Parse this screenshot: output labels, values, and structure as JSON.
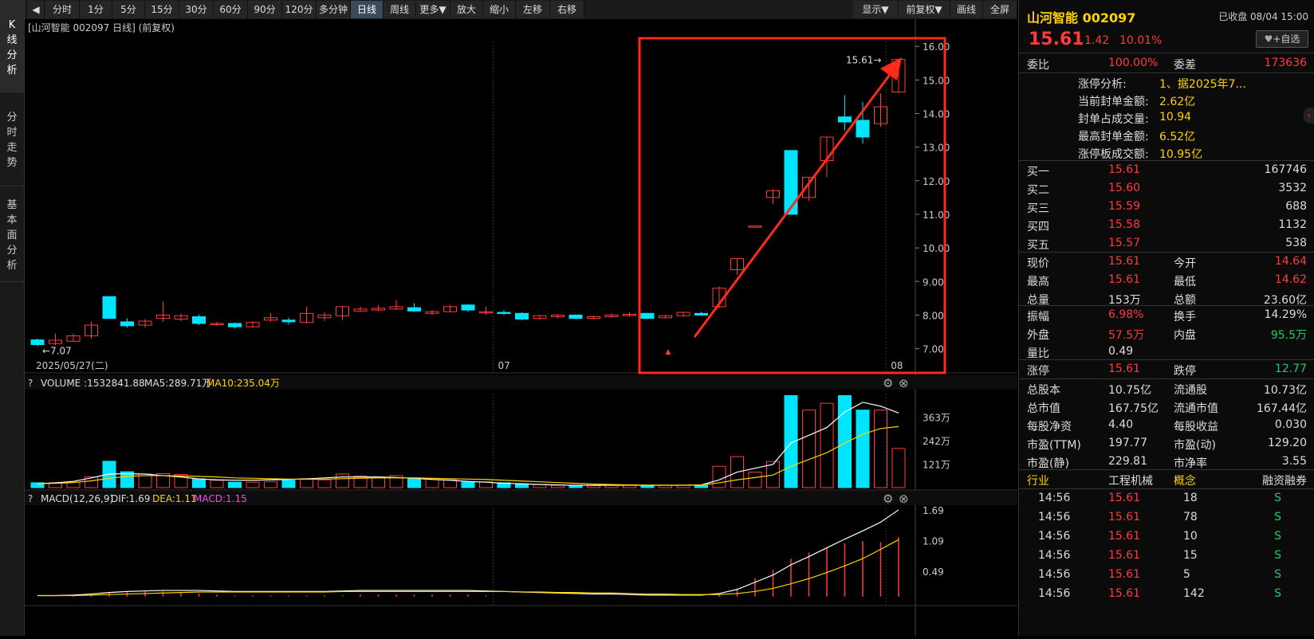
{
  "sidebar": {
    "tabs": [
      "K\n线\n分\n析",
      "分\n时\n走\n势",
      "基\n本\n面\n分\n析"
    ]
  },
  "toolbar": {
    "buttons": [
      "分时",
      "1分",
      "5分",
      "15分",
      "30分",
      "60分",
      "90分",
      "120分",
      "多分钟",
      "日线",
      "周线",
      "更多▼",
      "放大",
      "缩小",
      "左移",
      "右移"
    ],
    "right_buttons": [
      "显示▼",
      "前复权▼",
      "画线",
      "全屏"
    ],
    "active": "日线"
  },
  "chart": {
    "header": "[山河智能 002097 日线] (前复权)",
    "date_label": "2025/05/27(二)",
    "month_labels": [
      "07",
      "08"
    ],
    "low_marker": "7.07",
    "high_marker": "15.61",
    "price_ticks": [
      "16.00",
      "15.00",
      "14.00",
      "13.00",
      "12.00",
      "11.00",
      "10.00",
      "9.00",
      "8.00",
      "7.00"
    ]
  },
  "volume": {
    "label": "VOLUME",
    "value": ":1532841.88",
    "ma5": "MA5:289.71万",
    "ma10": "MA10:235.04万",
    "ticks": [
      "363万",
      "242万",
      "121万"
    ]
  },
  "macd": {
    "label": "MACD(12,26,9)",
    "dif": "DIF:1.69",
    "dea": "DEA:1.11",
    "macd": "MACD:1.15",
    "ticks": [
      "1.69",
      "1.09",
      "0.49"
    ]
  },
  "colors": {
    "up": "#ff3b3b",
    "down": "#00e5ff",
    "accent": "#ffd200",
    "annotation": "#ff2a1a"
  },
  "quote": {
    "name": "山河智能 002097",
    "status": "已收盘 08/04 15:00",
    "price": "15.61",
    "change": "1.42",
    "pct": "10.01%",
    "fav": "+自选",
    "webi_label": "委比",
    "webi": "100.00%",
    "weicha_label": "委差",
    "weicha": "173636",
    "limit_rows": [
      {
        "label": "涨停分析:",
        "value": "1、据2025年7..."
      },
      {
        "label": "当前封单金额:",
        "value": "2.62亿"
      },
      {
        "label": "封单占成交量:",
        "value": "10.94"
      },
      {
        "label": "最高封单金额:",
        "value": "6.52亿"
      },
      {
        "label": "涨停板成交额:",
        "value": "10.95亿"
      }
    ],
    "bids": [
      {
        "label": "买一",
        "price": "15.61",
        "vol": "167746"
      },
      {
        "label": "买二",
        "price": "15.60",
        "vol": "3532"
      },
      {
        "label": "买三",
        "price": "15.59",
        "vol": "688"
      },
      {
        "label": "买四",
        "price": "15.58",
        "vol": "1132"
      },
      {
        "label": "买五",
        "price": "15.57",
        "vol": "538"
      }
    ],
    "stats1": [
      {
        "l1": "现价",
        "v1": "15.61",
        "c1": "red",
        "l2": "今开",
        "v2": "14.64",
        "c2": "red"
      },
      {
        "l1": "最高",
        "v1": "15.61",
        "c1": "red",
        "l2": "最低",
        "v2": "14.62",
        "c2": "red"
      },
      {
        "l1": "总量",
        "v1": "153万",
        "c1": "white",
        "l2": "总额",
        "v2": "23.60亿",
        "c2": "white"
      }
    ],
    "stats2": [
      {
        "l1": "振幅",
        "v1": "6.98%",
        "c1": "red",
        "l2": "换手",
        "v2": "14.29%",
        "c2": "white"
      },
      {
        "l1": "外盘",
        "v1": "57.5万",
        "c1": "red",
        "l2": "内盘",
        "v2": "95.5万",
        "c2": "green"
      },
      {
        "l1": "量比",
        "v1": "0.49",
        "c1": "white",
        "l2": "",
        "v2": "",
        "c2": "white"
      }
    ],
    "stats3": [
      {
        "l1": "涨停",
        "v1": "15.61",
        "c1": "red",
        "l2": "跌停",
        "v2": "12.77",
        "c2": "green"
      }
    ],
    "stats4": [
      {
        "l1": "总股本",
        "v1": "10.75亿",
        "c1": "white",
        "l2": "流通股",
        "v2": "10.73亿",
        "c2": "white"
      },
      {
        "l1": "总市值",
        "v1": "167.75亿",
        "c1": "white",
        "l2": "流通市值",
        "v2": "167.44亿",
        "c2": "white"
      },
      {
        "l1": "每股净资",
        "v1": "4.40",
        "c1": "white",
        "l2": "每股收益",
        "v2": "0.030",
        "c2": "white"
      },
      {
        "l1": "市盈(TTM)",
        "v1": "197.77",
        "c1": "white",
        "l2": "市盈(动)",
        "v2": "129.20",
        "c2": "white"
      },
      {
        "l1": "市盈(静)",
        "v1": "229.81",
        "c1": "white",
        "l2": "市净率",
        "v2": "3.55",
        "c2": "white"
      }
    ],
    "industry": {
      "l1": "行业",
      "v1": "工程机械",
      "l2": "概念",
      "v2": "融资融券"
    },
    "ticks": [
      {
        "time": "14:56",
        "price": "15.61",
        "vol": "18",
        "side": "S"
      },
      {
        "time": "14:56",
        "price": "15.61",
        "vol": "78",
        "side": "S"
      },
      {
        "time": "14:56",
        "price": "15.61",
        "vol": "10",
        "side": "S"
      },
      {
        "time": "14:56",
        "price": "15.61",
        "vol": "15",
        "side": "S"
      },
      {
        "time": "14:56",
        "price": "15.61",
        "vol": "5",
        "side": "S"
      },
      {
        "time": "14:56",
        "price": "15.61",
        "vol": "142",
        "side": "S"
      }
    ]
  },
  "chart_data": {
    "type": "candlestick",
    "title": "山河智能 002097 日线",
    "ylim": [
      6.8,
      16.1
    ],
    "candles": [
      {
        "o": 7.26,
        "c": 7.12,
        "h": 7.3,
        "l": 7.07
      },
      {
        "o": 7.15,
        "c": 7.25,
        "h": 7.45,
        "l": 7.1
      },
      {
        "o": 7.22,
        "c": 7.38,
        "h": 7.45,
        "l": 7.2
      },
      {
        "o": 7.38,
        "c": 7.7,
        "h": 7.8,
        "l": 7.3
      },
      {
        "o": 8.55,
        "c": 7.9,
        "h": 8.55,
        "l": 7.88
      },
      {
        "o": 7.8,
        "c": 7.68,
        "h": 7.9,
        "l": 7.62
      },
      {
        "o": 7.7,
        "c": 7.82,
        "h": 7.88,
        "l": 7.62
      },
      {
        "o": 7.9,
        "c": 8.0,
        "h": 8.4,
        "l": 7.8
      },
      {
        "o": 7.88,
        "c": 7.98,
        "h": 8.05,
        "l": 7.82
      },
      {
        "o": 7.95,
        "c": 7.75,
        "h": 8.02,
        "l": 7.7
      },
      {
        "o": 7.72,
        "c": 7.75,
        "h": 7.8,
        "l": 7.68
      },
      {
        "o": 7.75,
        "c": 7.65,
        "h": 7.78,
        "l": 7.6
      },
      {
        "o": 7.65,
        "c": 7.78,
        "h": 7.82,
        "l": 7.62
      },
      {
        "o": 7.85,
        "c": 7.92,
        "h": 8.05,
        "l": 7.8
      },
      {
        "o": 7.85,
        "c": 7.8,
        "h": 7.92,
        "l": 7.72
      },
      {
        "o": 7.78,
        "c": 8.05,
        "h": 8.25,
        "l": 7.75
      },
      {
        "o": 7.92,
        "c": 8.0,
        "h": 8.08,
        "l": 7.82
      },
      {
        "o": 7.98,
        "c": 8.25,
        "h": 8.25,
        "l": 7.85
      },
      {
        "o": 8.12,
        "c": 8.18,
        "h": 8.25,
        "l": 8.1
      },
      {
        "o": 8.15,
        "c": 8.2,
        "h": 8.3,
        "l": 8.12
      },
      {
        "o": 8.18,
        "c": 8.25,
        "h": 8.45,
        "l": 8.15
      },
      {
        "o": 8.22,
        "c": 8.12,
        "h": 8.35,
        "l": 8.1
      },
      {
        "o": 8.05,
        "c": 8.1,
        "h": 8.15,
        "l": 8.0
      },
      {
        "o": 8.1,
        "c": 8.25,
        "h": 8.3,
        "l": 8.08
      },
      {
        "o": 8.3,
        "c": 8.15,
        "h": 8.32,
        "l": 8.1
      },
      {
        "o": 8.1,
        "c": 8.1,
        "h": 8.25,
        "l": 8.0
      },
      {
        "o": 8.08,
        "c": 8.05,
        "h": 8.15,
        "l": 8.0
      },
      {
        "o": 8.05,
        "c": 7.88,
        "h": 8.08,
        "l": 7.85
      },
      {
        "o": 7.9,
        "c": 7.98,
        "h": 8.0,
        "l": 7.85
      },
      {
        "o": 7.95,
        "c": 8.0,
        "h": 8.02,
        "l": 7.9
      },
      {
        "o": 8.0,
        "c": 7.9,
        "h": 8.02,
        "l": 7.88
      },
      {
        "o": 7.9,
        "c": 7.95,
        "h": 7.98,
        "l": 7.88
      },
      {
        "o": 7.95,
        "c": 8.0,
        "h": 8.05,
        "l": 7.92
      },
      {
        "o": 8.0,
        "c": 8.02,
        "h": 8.08,
        "l": 7.95
      },
      {
        "o": 8.05,
        "c": 7.9,
        "h": 8.05,
        "l": 7.88
      },
      {
        "o": 7.92,
        "c": 7.98,
        "h": 8.0,
        "l": 7.9
      },
      {
        "o": 7.98,
        "c": 8.08,
        "h": 8.1,
        "l": 7.95
      },
      {
        "o": 8.05,
        "c": 8.0,
        "h": 8.1,
        "l": 7.98
      },
      {
        "o": 8.25,
        "c": 8.8,
        "h": 8.85,
        "l": 8.2
      },
      {
        "o": 9.35,
        "c": 9.68,
        "h": 9.68,
        "l": 9.2
      },
      {
        "o": 10.65,
        "c": 10.65,
        "h": 10.65,
        "l": 10.65
      },
      {
        "o": 11.5,
        "c": 11.7,
        "h": 11.75,
        "l": 11.3
      },
      {
        "o": 12.9,
        "c": 11.0,
        "h": 12.9,
        "l": 11.0
      },
      {
        "o": 11.5,
        "c": 12.1,
        "h": 12.1,
        "l": 11.4
      },
      {
        "o": 12.6,
        "c": 13.3,
        "h": 13.3,
        "l": 12.1
      },
      {
        "o": 13.9,
        "c": 13.75,
        "h": 14.55,
        "l": 13.5
      },
      {
        "o": 13.8,
        "c": 13.3,
        "h": 14.35,
        "l": 13.1
      },
      {
        "o": 13.7,
        "c": 14.2,
        "h": 14.6,
        "l": 13.6
      },
      {
        "o": 14.64,
        "c": 15.61,
        "h": 15.61,
        "l": 14.62
      }
    ],
    "volume": [
      0.25,
      0.25,
      0.28,
      0.55,
      1.36,
      0.82,
      0.7,
      0.72,
      0.68,
      0.45,
      0.38,
      0.28,
      0.28,
      0.3,
      0.38,
      0.46,
      0.4,
      0.7,
      0.6,
      0.5,
      0.62,
      0.5,
      0.48,
      0.4,
      0.28,
      0.3,
      0.25,
      0.18,
      0.16,
      0.12,
      0.1,
      0.1,
      0.12,
      0.14,
      0.1,
      0.12,
      0.12,
      0.12,
      1.1,
      1.6,
      0.8,
      1.35,
      4.75,
      4.0,
      4.35,
      4.75,
      4.0,
      4.0,
      2.02
    ],
    "volume_ylim": [
      0,
      4.85
    ],
    "ma5_curve": [
      0.2,
      0.25,
      0.32,
      0.5,
      0.7,
      0.72,
      0.7,
      0.62,
      0.55,
      0.45,
      0.4,
      0.38,
      0.38,
      0.4,
      0.42,
      0.45,
      0.5,
      0.55,
      0.55,
      0.55,
      0.52,
      0.48,
      0.42,
      0.38,
      0.32,
      0.28,
      0.22,
      0.2,
      0.16,
      0.14,
      0.12,
      0.12,
      0.12,
      0.12,
      0.12,
      0.12,
      0.12,
      0.14,
      0.4,
      0.8,
      1.0,
      1.2,
      2.3,
      2.7,
      3.1,
      3.9,
      4.4,
      4.2,
      3.85
    ],
    "ma10_curve": [
      0.2,
      0.22,
      0.26,
      0.35,
      0.48,
      0.58,
      0.62,
      0.62,
      0.6,
      0.58,
      0.55,
      0.5,
      0.48,
      0.46,
      0.44,
      0.43,
      0.44,
      0.46,
      0.48,
      0.5,
      0.5,
      0.5,
      0.48,
      0.46,
      0.44,
      0.42,
      0.38,
      0.34,
      0.3,
      0.26,
      0.22,
      0.18,
      0.16,
      0.14,
      0.13,
      0.13,
      0.13,
      0.14,
      0.25,
      0.4,
      0.52,
      0.65,
      1.1,
      1.45,
      1.8,
      2.3,
      2.75,
      3.05,
      3.15
    ],
    "macd_dif": [
      0.02,
      0.02,
      0.03,
      0.05,
      0.08,
      0.1,
      0.11,
      0.12,
      0.12,
      0.12,
      0.11,
      0.1,
      0.1,
      0.1,
      0.1,
      0.1,
      0.1,
      0.11,
      0.12,
      0.12,
      0.12,
      0.12,
      0.12,
      0.12,
      0.12,
      0.11,
      0.1,
      0.09,
      0.08,
      0.07,
      0.06,
      0.05,
      0.05,
      0.04,
      0.03,
      0.03,
      0.03,
      0.03,
      0.06,
      0.14,
      0.28,
      0.42,
      0.62,
      0.78,
      0.95,
      1.12,
      1.28,
      1.45,
      1.69
    ],
    "macd_dea": [
      0.02,
      0.02,
      0.02,
      0.03,
      0.04,
      0.05,
      0.06,
      0.07,
      0.08,
      0.09,
      0.09,
      0.09,
      0.09,
      0.09,
      0.09,
      0.09,
      0.09,
      0.1,
      0.1,
      0.1,
      0.1,
      0.1,
      0.1,
      0.1,
      0.1,
      0.1,
      0.1,
      0.09,
      0.09,
      0.08,
      0.08,
      0.07,
      0.07,
      0.06,
      0.05,
      0.05,
      0.04,
      0.04,
      0.04,
      0.06,
      0.1,
      0.16,
      0.25,
      0.35,
      0.47,
      0.6,
      0.74,
      0.92,
      1.11
    ],
    "macd_ylim": [
      -0.05,
      1.72
    ]
  }
}
